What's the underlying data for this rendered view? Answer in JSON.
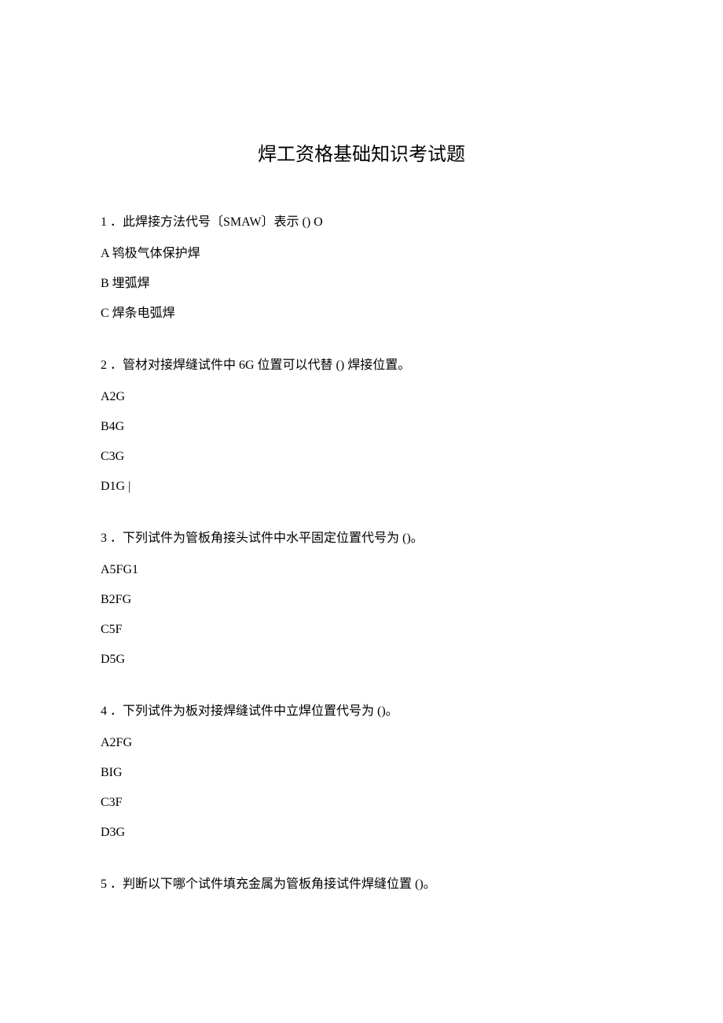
{
  "title": "焊工资格基础知识考试题",
  "questions": [
    {
      "number": "1",
      "stem": "．此焊接方法代号〔SMAW〕表示 () O",
      "options": [
        "A 鸨极气体保护焊",
        "B 埋弧焊",
        "C 焊条电弧焊"
      ]
    },
    {
      "number": "2",
      "stem": "．管材对接焊缝试件中 6G 位置可以代替 () 焊接位置。",
      "options": [
        "A2G",
        "B4G",
        "C3G",
        "D1G |"
      ]
    },
    {
      "number": "3",
      "stem": "．下列试件为管板角接头试件中水平固定位置代号为 ()。",
      "options": [
        "A5FG1",
        "B2FG",
        "C5F",
        "D5G"
      ]
    },
    {
      "number": "4",
      "stem": "．下列试件为板对接焊缝试件中立焊位置代号为 ()。",
      "options": [
        "A2FG",
        "BIG",
        "C3F",
        "D3G"
      ]
    },
    {
      "number": "5",
      "stem": "．判断以下哪个试件填充金属为管板角接试件焊缝位置 ()。",
      "options": []
    }
  ]
}
